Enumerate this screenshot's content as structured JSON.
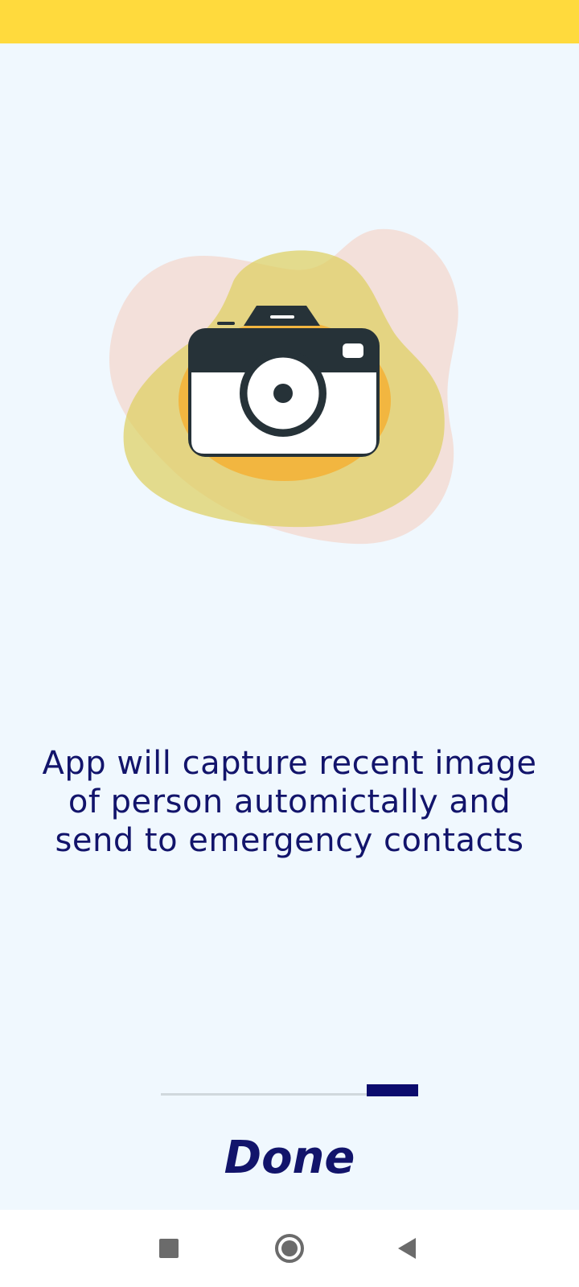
{
  "onboarding": {
    "illustration_icon": "camera-icon",
    "description": "App will capture recent image of person automictally and send to emergency contacts",
    "progress_current_page": 3,
    "progress_total_pages": 3,
    "done_label": "Done"
  },
  "colors": {
    "status_bar": "#FFDA3D",
    "background": "#F0F8FE",
    "text_primary": "#12146B",
    "progress_active": "#0C0C6E",
    "progress_track": "#D0D8DC"
  },
  "nav_bar": {
    "recents_icon": "square-icon",
    "home_icon": "circle-icon",
    "back_icon": "triangle-back-icon"
  }
}
